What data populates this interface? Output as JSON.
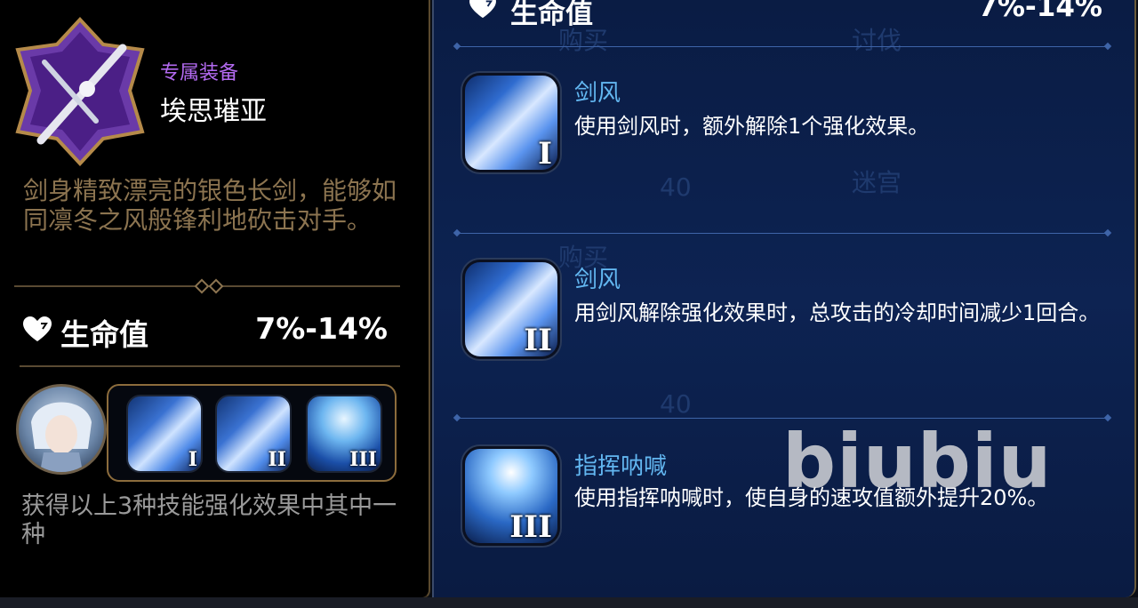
{
  "equipment": {
    "type_label": "专属装备",
    "name": "埃思璀亚",
    "description": "剑身精致漂亮的银色长剑，能够如同凛冬之风般锋利地砍击对手。",
    "stat": {
      "icon": "heart-icon",
      "label": "生命值",
      "value": "7%-14%"
    },
    "skills": [
      {
        "icon": "sword-wind-icon",
        "level": "I"
      },
      {
        "icon": "sword-wind-icon",
        "level": "II"
      },
      {
        "icon": "frost-command-icon",
        "level": "III"
      }
    ],
    "note": "获得以上3种技能强化效果中其中一种"
  },
  "detail": {
    "stat": {
      "icon": "heart-icon",
      "label": "生命值",
      "value": "7%-14%"
    },
    "skills": [
      {
        "level": "I",
        "name": "剑风",
        "desc": "使用剑风时，额外解除1个强化效果。"
      },
      {
        "level": "II",
        "name": "剑风",
        "desc": "用剑风解除强化效果时，总攻击的冷却时间减少1回合。"
      },
      {
        "level": "III",
        "name": "指挥呐喊",
        "desc": "使用指挥呐喊时，使自身的速攻值额外提升20%。"
      }
    ],
    "background_labels": [
      "购买",
      "讨伐",
      "40",
      "迷宫",
      "购买",
      "40"
    ]
  },
  "watermark": "biubiu",
  "colors": {
    "type_label": "#b36af0",
    "skill_name": "#62b6f0",
    "description": "#8c7450",
    "panel_bg": "#0d2352"
  }
}
